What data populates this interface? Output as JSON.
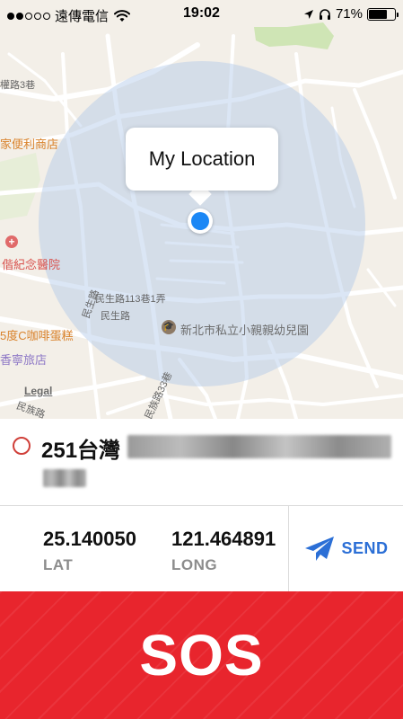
{
  "status_bar": {
    "signal_dots_filled": 2,
    "signal_dots_total": 5,
    "carrier": "遠傳電信",
    "time": "19:02",
    "battery_percent": "71%",
    "battery_level": 0.71,
    "icons": [
      "wifi-icon",
      "location-arrow-icon",
      "headphones-icon",
      "battery-icon"
    ]
  },
  "map": {
    "callout": "My Location",
    "legal": "Legal",
    "pois": {
      "convenience_store": "家便利商店",
      "memorial_hospital": "偕紀念醫院",
      "coffee_shop": "5度C咖啡蛋糕",
      "hotel": "香寧旅店",
      "kindergarten": "新北市私立小親親幼兒園"
    },
    "roads": {
      "lane_top": "權路3巷",
      "minsheng_lane": "民生路113巷1弄",
      "minsheng": "民生路",
      "minsheng_vertical": "民生路",
      "minzu": "民族路",
      "minzu_33": "民族路33巷"
    }
  },
  "address": {
    "visible_text": "251台灣"
  },
  "coordinates": {
    "lat_value": "25.140050",
    "lat_label": "LAT",
    "long_value": "121.464891",
    "long_label": "LONG"
  },
  "actions": {
    "send_label": "SEND",
    "sos_label": "SOS"
  },
  "colors": {
    "sos_red": "#e8252d",
    "send_blue": "#2b6fd6",
    "location_blue": "#1b87f5",
    "map_bg": "#f3efe8"
  }
}
